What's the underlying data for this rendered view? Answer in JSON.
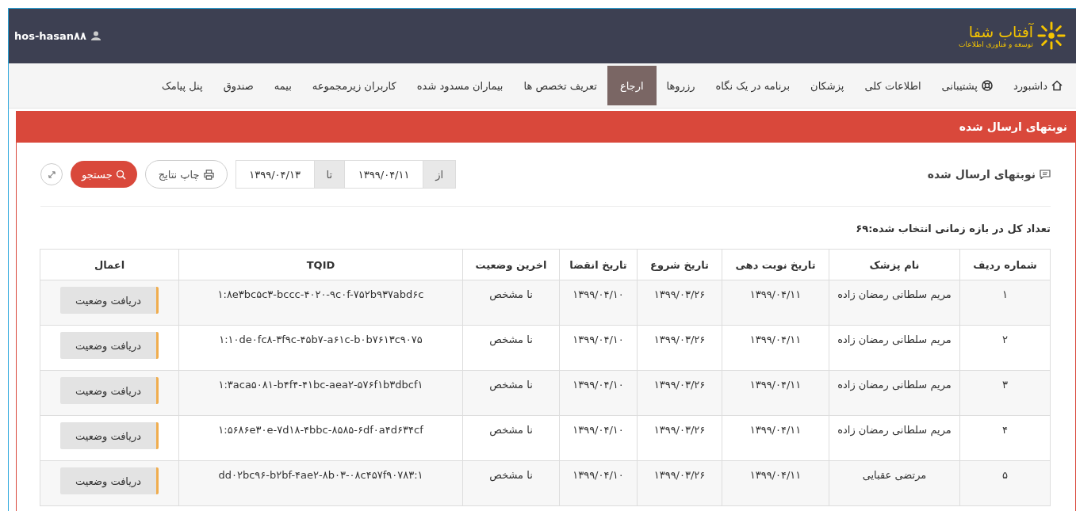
{
  "header": {
    "logo_title": "آفتاب شفا",
    "logo_subtitle": "توسعه و فناوری اطلاعات",
    "user": "hos-hasan۸۸"
  },
  "nav": [
    {
      "label": "داشبورد",
      "selected": false
    },
    {
      "label": "پشتیبانی",
      "selected": false
    },
    {
      "label": "اطلاعات کلی",
      "selected": false
    },
    {
      "label": "پزشکان",
      "selected": false
    },
    {
      "label": "برنامه در یک نگاه",
      "selected": false
    },
    {
      "label": "رزروها",
      "selected": false
    },
    {
      "label": "ارجاع",
      "selected": true
    },
    {
      "label": "تعریف تخصص ها",
      "selected": false
    },
    {
      "label": "بیماران مسدود شده",
      "selected": false
    },
    {
      "label": "کاربران زیرمجموعه",
      "selected": false
    },
    {
      "label": "بیمه",
      "selected": false
    },
    {
      "label": "صندوق",
      "selected": false
    },
    {
      "label": "پنل پیامک",
      "selected": false
    }
  ],
  "panel": {
    "title": "نوبتهای ارسال شده",
    "subtitle": "نوبتهای ارسال شده",
    "from_label": "از",
    "from_value": "۱۳۹۹/۰۴/۱۱",
    "to_label": "تا",
    "to_value": "۱۳۹۹/۰۴/۱۳",
    "print_button": "چاپ نتایج",
    "search_button": "جستجو",
    "total": "تعداد کل در بازه زمانی انتخاب شده:۶۹"
  },
  "table": {
    "columns": [
      "شماره ردیف",
      "نام پزشک",
      "تاریخ نوبت دهی",
      "تاریخ شروع",
      "تاریخ انقضا",
      "اخرین وضعیت",
      "TQID",
      "اعمال"
    ],
    "rows": [
      {
        "row": "۱",
        "doctor": "مریم سلطانی رمضان زاده",
        "booking_date": "۱۳۹۹/۰۴/۱۱",
        "start_date": "۱۳۹۹/۰۳/۲۶",
        "expiry_date": "۱۳۹۹/۰۴/۱۰",
        "status": "نا مشخص",
        "tqid": "۱:۸e۳bc۵c۳-bccc-۴۰۲۰-۹c۰f-۷۵۲b۹۳۷abd۶c",
        "action": "دریافت وضعیت"
      },
      {
        "row": "۲",
        "doctor": "مریم سلطانی رمضان زاده",
        "booking_date": "۱۳۹۹/۰۴/۱۱",
        "start_date": "۱۳۹۹/۰۳/۲۶",
        "expiry_date": "۱۳۹۹/۰۴/۱۰",
        "status": "نا مشخص",
        "tqid": "۱:۱۰de۰fc۸-۳f۹c-۴۵b۷-a۶۱c-b۰b۷۶۱۳c۹۰۷۵",
        "action": "دریافت وضعیت"
      },
      {
        "row": "۳",
        "doctor": "مریم سلطانی رمضان زاده",
        "booking_date": "۱۳۹۹/۰۴/۱۱",
        "start_date": "۱۳۹۹/۰۳/۲۶",
        "expiry_date": "۱۳۹۹/۰۴/۱۰",
        "status": "نا مشخص",
        "tqid": "۱:۳aca۵۰۸۱-b۴f۴-۴۱bc-aea۲-۵۷۶f۱b۳dbcf۱",
        "action": "دریافت وضعیت"
      },
      {
        "row": "۴",
        "doctor": "مریم سلطانی رمضان زاده",
        "booking_date": "۱۳۹۹/۰۴/۱۱",
        "start_date": "۱۳۹۹/۰۳/۲۶",
        "expiry_date": "۱۳۹۹/۰۴/۱۰",
        "status": "نا مشخص",
        "tqid": "۱:۵۶۸۶e۳۰e-۷d۱۸-۴bbc-۸۵۸۵-۶df۰a۴d۶۳۴cf",
        "action": "دریافت وضعیت"
      },
      {
        "row": "۵",
        "doctor": "مرتضی عقبایی",
        "booking_date": "۱۳۹۹/۰۴/۱۱",
        "start_date": "۱۳۹۹/۰۳/۲۶",
        "expiry_date": "۱۳۹۹/۰۴/۱۰",
        "status": "نا مشخص",
        "tqid": "dd۰۲bc۹۶-b۲bf-۴ae۲-۸b۰۳-۰۸c۴۵۷f۹۰۷۸۳:۱",
        "action": "دریافت وضعیت"
      }
    ]
  }
}
